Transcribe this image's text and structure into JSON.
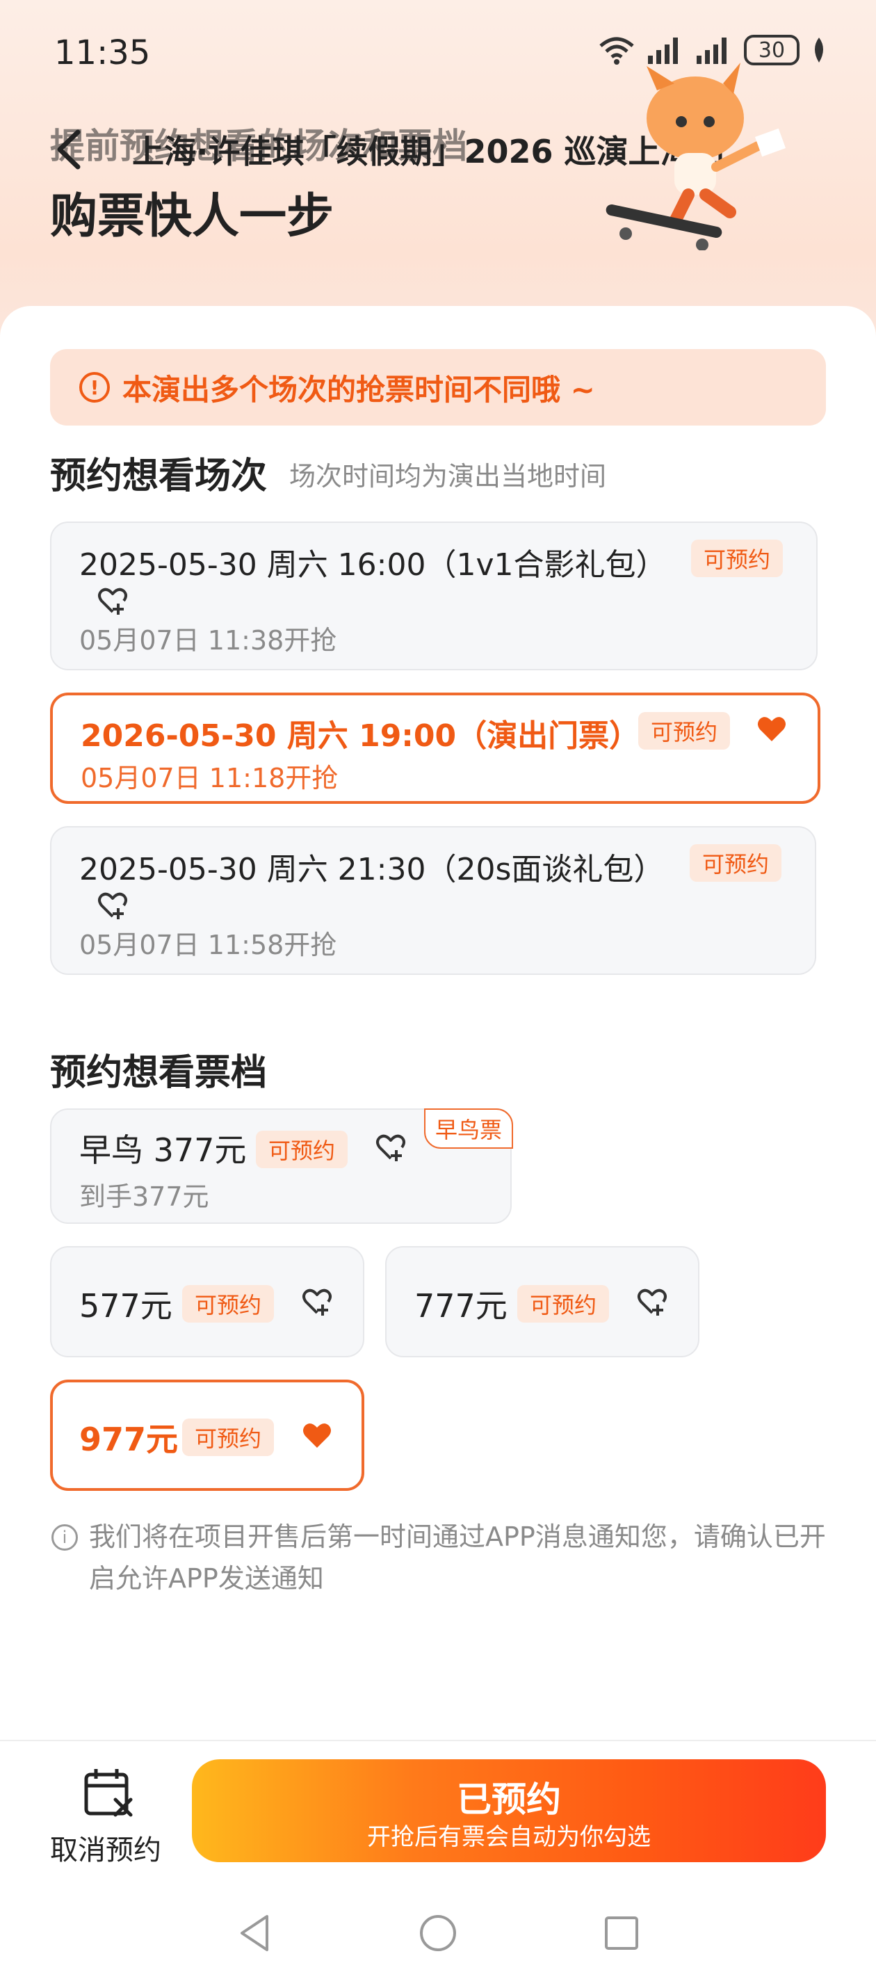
{
  "status_bar": {
    "time": "11:35",
    "battery": "30"
  },
  "header": {
    "ghost_title": "提前预约想看的场次和票档",
    "nav_title": "上海·许佳琪「续假期」2026 巡演上海站",
    "hero_title": "购票快人一步"
  },
  "notice": {
    "text": "本演出多个场次的抢票时间不同哦 ~"
  },
  "sessions_section": {
    "title": "预约想看场次",
    "subtitle": "场次时间均为演出当地时间",
    "items": [
      {
        "title": "2025-05-30 周六 16:00（1v1合影礼包）",
        "badge": "可预约",
        "open_time": "05月07日 11:38开抢",
        "selected": false
      },
      {
        "title": "2026-05-30 周六 19:00（演出门票）",
        "badge": "可预约",
        "open_time": "05月07日 11:18开抢",
        "selected": true
      },
      {
        "title": "2025-05-30 周六 21:30（20s面谈礼包）",
        "badge": "可预约",
        "open_time": "05月07日 11:58开抢",
        "selected": false
      }
    ]
  },
  "tiers_section": {
    "title": "预约想看票档",
    "items": [
      {
        "price": "早鸟 377元",
        "badge": "可预约",
        "sub": "到手377元",
        "tag": "早鸟票",
        "selected": false
      },
      {
        "price": "577元",
        "badge": "可预约",
        "selected": false
      },
      {
        "price": "777元",
        "badge": "可预约",
        "selected": false
      },
      {
        "price": "977元",
        "badge": "可预约",
        "selected": true
      }
    ]
  },
  "info": {
    "text": "我们将在项目开售后第一时间通过APP消息通知您，请确认已开启允许APP发送通知"
  },
  "bottom": {
    "cancel_label": "取消预约",
    "cta_main": "已预约",
    "cta_sub": "开抢后有票会自动为你勾选"
  },
  "colors": {
    "accent": "#f05a14",
    "badge_bg": "#fde8dc",
    "card_bg": "#f6f7f9"
  },
  "icons": [
    "back-arrow-icon",
    "wifi-icon",
    "signal-icon",
    "battery-icon",
    "leaf-icon",
    "alert-icon",
    "heart-add-icon",
    "heart-filled-icon",
    "info-icon",
    "calendar-cancel-icon",
    "nav-back-icon",
    "nav-home-icon",
    "nav-recent-icon"
  ]
}
